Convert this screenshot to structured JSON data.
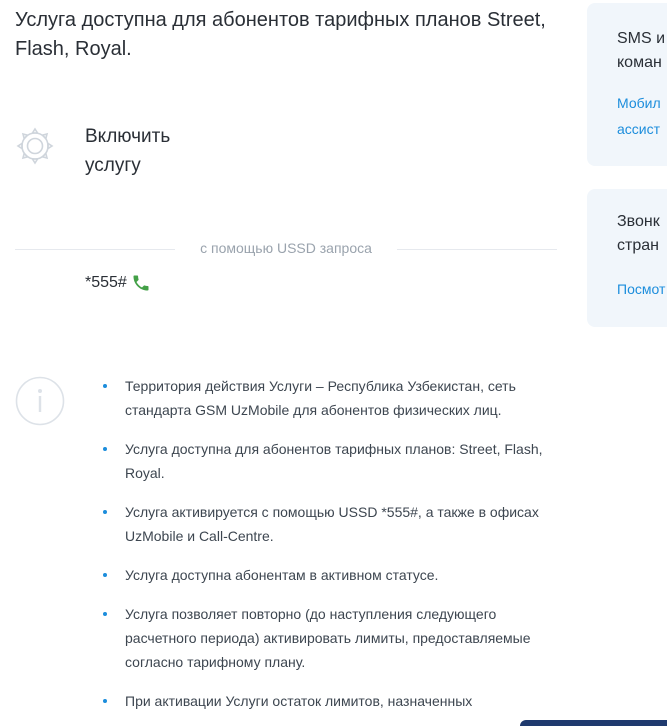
{
  "headline": "Услуга доступна для абонентов тарифных планов Street, Flash, Royal.",
  "enable": {
    "line1": "Включить",
    "line2": "услугу"
  },
  "ussd": {
    "label": "с помощью USSD запроса",
    "code": "*555#"
  },
  "notes": [
    "Территория действия Услуги – Республика Узбекистан, сеть стандарта GSM UzMobile для абонентов физических лиц.",
    "Услуга доступна для абонентов тарифных планов: Street, Flash, Royal.",
    "Услуга активируется с помощью USSD *555#, а также в офисах UzMobile и Call-Centre.",
    "Услуга доступна абонентам в активном статусе.",
    "Услуга позволяет повторно (до наступления следующего расчетного периода) активировать лимиты, предоставляемые согласно тарифному плану.",
    "При активации Услуги остаток лимитов, назначенных"
  ],
  "sidebar": {
    "card1": {
      "title_line1": "SMS и",
      "title_line2": "коман",
      "link_line1": "Мобил",
      "link_line2": "ассист"
    },
    "card2": {
      "title_line1": "Звонк",
      "title_line2": "стран",
      "link": "Посмот"
    }
  },
  "colors": {
    "accent": "#1c8ddc",
    "phone_icon": "#43a047",
    "card_bg": "#f1f6fb"
  },
  "icons": {
    "settings": "gear-icon",
    "info": "info-icon",
    "phone": "phone-icon"
  }
}
